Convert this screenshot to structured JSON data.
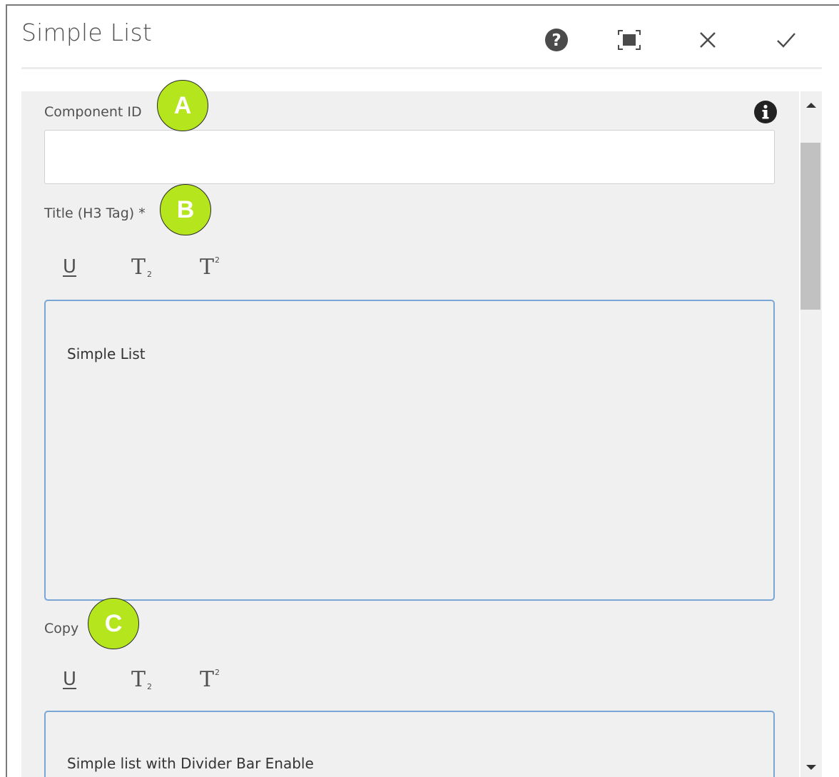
{
  "dialog": {
    "title": "Simple List",
    "actions": {
      "help_icon": "question-circle",
      "fullscreen_icon": "fullscreen",
      "close_icon": "close-x",
      "confirm_icon": "checkmark"
    }
  },
  "form": {
    "component_id": {
      "label": "Component ID",
      "value": "",
      "placeholder": "",
      "info_icon": "info-circle"
    },
    "title_field": {
      "label": "Title (H3 Tag) *",
      "toolbar": {
        "underline": "U",
        "subscript": "T",
        "subscript_mark": "2",
        "superscript": "T",
        "superscript_mark": "2"
      },
      "value": "Simple List"
    },
    "copy_field": {
      "label": "Copy",
      "toolbar": {
        "underline": "U",
        "subscript": "T",
        "subscript_mark": "2",
        "superscript": "T",
        "superscript_mark": "2"
      },
      "value": "Simple list with Divider Bar Enable"
    }
  },
  "markers": [
    "A",
    "B",
    "C"
  ],
  "colors": {
    "marker": "#b5e51d",
    "rte_border": "#7aa6d6",
    "panel": "#f0f0f0",
    "scroll_thumb": "#c1c1c1"
  }
}
